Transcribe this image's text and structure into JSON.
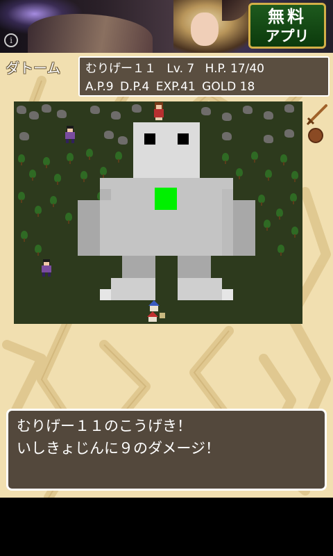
{
  "ad": {
    "free_line1": "無料",
    "free_line2": "アプリ",
    "info_glyph": "i",
    "icon": "info-icon"
  },
  "location": "ダトーム",
  "status": {
    "name": "むりげー１１",
    "level": "Lv.  7",
    "hp": "H.P. 17/40",
    "ap": "A.P.9",
    "dp": "D.P.4",
    "exp": "EXP.41",
    "gold": "GOLD 18"
  },
  "equipment": {
    "weapon_icon": "sword-icon",
    "shield_icon": "shield-icon"
  },
  "enemy": {
    "icon": "stone-golem-sprite",
    "color": "#b8b8b8",
    "gem_color": "#00f000"
  },
  "message": {
    "line1": "むりげー１１のこうげき！",
    "line2": "いしきょじんに９のダメージ！"
  },
  "colors": {
    "parchment": "#f1dfb0",
    "panel": "#5a4e40",
    "map_ground": "#2d3a1d"
  }
}
